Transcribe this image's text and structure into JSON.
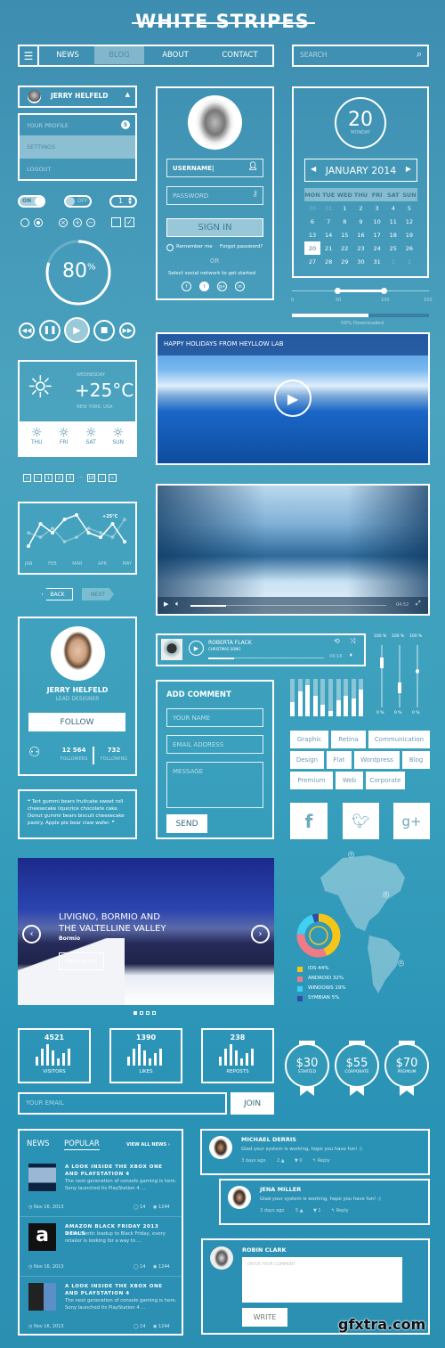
{
  "title": "WHITE STRIPES",
  "nav": {
    "items": [
      "NEWS",
      "BLOG",
      "ABOUT",
      "CONTACT"
    ],
    "active": "BLOG"
  },
  "search": {
    "placeholder": "SEARCH"
  },
  "user_menu": {
    "name": "JERRY HELFELD",
    "items": [
      "YOUR PROFILE",
      "SETTINGS",
      "LOGOUT"
    ],
    "badge": "5",
    "active": "SETTINGS"
  },
  "controls": {
    "toggle_on": "ON",
    "toggle_off": "OFF",
    "stepper_value": "1"
  },
  "gauge": {
    "value": 80,
    "label": "80",
    "unit": "%"
  },
  "login": {
    "username": "USERNAME",
    "password_placeholder": "PASSWORD",
    "sign_in": "SIGN IN",
    "remember": "Remember me",
    "forgot": "Forgot password?",
    "or": "OR",
    "social_text": "Select social network to get started",
    "social": [
      "f",
      "t",
      "g+",
      "in"
    ]
  },
  "calendar": {
    "day": "20",
    "weekday": "MONDAY",
    "month": "JANUARY 2014",
    "headers": [
      "MON",
      "TUE",
      "WED",
      "THU",
      "FRI",
      "SAT",
      "SUN"
    ],
    "weeks": [
      [
        "30",
        "31",
        "1",
        "2",
        "3",
        "4",
        "5"
      ],
      [
        "6",
        "7",
        "8",
        "9",
        "10",
        "11",
        "12"
      ],
      [
        "13",
        "14",
        "15",
        "16",
        "17",
        "18",
        "19"
      ],
      [
        "20",
        "21",
        "22",
        "23",
        "24",
        "25",
        "26"
      ],
      [
        "27",
        "28",
        "29",
        "30",
        "31",
        "1",
        "2"
      ]
    ],
    "selected": "20"
  },
  "range_slider": {
    "ticks": [
      "0",
      "50",
      "100",
      "150"
    ],
    "low": 50,
    "high": 100
  },
  "download": {
    "percent": 56,
    "label": "56% Downloaded"
  },
  "weather": {
    "day": "WEDNESDAY",
    "temp": "+25°C",
    "location": "NEW YORK, USA",
    "forecast": [
      "THU",
      "FRI",
      "SAT",
      "SUN"
    ]
  },
  "video1": {
    "title": "HAPPY HOLIDAYS FROM HEYLLOW LAB"
  },
  "video2": {
    "time": "04:52",
    "progress": 0.18
  },
  "pagination": [
    "«",
    "‹",
    "1",
    "2",
    "3",
    "...",
    "10",
    "›",
    "»"
  ],
  "line_chart": {
    "months": [
      "JAN",
      "FEB",
      "MAR",
      "APR",
      "MAY"
    ],
    "annotation": "+25°C",
    "series1": [
      2,
      7,
      5,
      8,
      9,
      5,
      4,
      7,
      3
    ],
    "series2": [
      5,
      4,
      6,
      3,
      4,
      6,
      5,
      4,
      8
    ]
  },
  "back_next": {
    "back": "BACK",
    "next": "NEXT"
  },
  "profile": {
    "name": "JERRY HELFELD",
    "role": "LEAD DESIGNER",
    "follow": "FOLLOW",
    "followers": "12 564",
    "followers_label": "FOLLOWERS",
    "following": "732",
    "following_label": "FOLLOWING"
  },
  "quote": {
    "text": "Tart gummi bears fruitcake sweet roll cheesecake liquorice chocolate cake. Donut gummi bears biscuit cheesecake pastry. Apple pie bear claw wafer."
  },
  "music": {
    "artist": "ROBERTA FLACK",
    "song": "CHRISTMAS SONG",
    "time": "04:18",
    "progress": 0.22
  },
  "volume": {
    "top_labels": [
      "100 %",
      "100 %",
      "100 %"
    ],
    "bottom_labels": [
      "0 %",
      "0 %",
      "0 %"
    ],
    "levels": [
      0.8,
      0.4,
      0.62
    ]
  },
  "equalizer": [
    0.38,
    0.67,
    0.83,
    0.55,
    0.3,
    0.15,
    0.42,
    0.55,
    0.48,
    0.72
  ],
  "comment_form": {
    "title": "ADD COMMENT",
    "name": "YOUR NAME",
    "email": "EMAIL ADDRESS",
    "message": "MESSAGE",
    "send": "SEND"
  },
  "tags": [
    "Graphic",
    "Retina",
    "Communication",
    "Design",
    "Flat",
    "Wordpress",
    "Blog",
    "Premium",
    "Web",
    "Corporate"
  ],
  "social_buttons": [
    "f",
    "🐦",
    "g+"
  ],
  "slider": {
    "title1": "LIVIGNO,  BORMIO AND",
    "title2": "THE VALTELLINE VALLEY",
    "subtitle": "Bormio",
    "button": "VIEW MORE",
    "slides": 4,
    "active": 0
  },
  "donut": {
    "items": [
      {
        "label": "IOS",
        "value": 44,
        "color": "#f5c518"
      },
      {
        "label": "ANDROID",
        "value": 32,
        "color": "#f07a86"
      },
      {
        "label": "WINDOWS",
        "value": 19,
        "color": "#3fd0f2"
      },
      {
        "label": "SYMBIAN",
        "value": 5,
        "color": "#2e4fa8"
      }
    ],
    "texts": [
      "IOS  44%",
      "ANDROID  32%",
      "WINDOWS  19%",
      "SYMBIAN  5%"
    ]
  },
  "stats": [
    {
      "value": "4521",
      "label": "VISITORS"
    },
    {
      "value": "1390",
      "label": "LIKES"
    },
    {
      "value": "238",
      "label": "REPOSTS"
    }
  ],
  "pricing": [
    {
      "price": "$30",
      "label": "STARTED"
    },
    {
      "price": "$55",
      "label": "CORPORATE"
    },
    {
      "price": "$70",
      "label": "PREMIUM"
    }
  ],
  "newsletter": {
    "placeholder": "YOUR EMAIL",
    "button": "JOIN"
  },
  "news": {
    "tabs": [
      "NEWS",
      "POPULAR"
    ],
    "view_all": "VIEW ALL NEWS ›",
    "items": [
      {
        "title": "A LOOK INSIDE THE XBOX ONE AND PLAYSTATION 4",
        "text": "The next generation of console gaming is here. Sony launched its PlayStation 4 ...",
        "date": "Nov 16, 2013",
        "comments": "14",
        "views": "1244"
      },
      {
        "title": "AMAZON BLACK FRIDAY 2013 DEALS",
        "text": "In the frantic leadup to Black Friday, every retailer is looking for a way to ...",
        "date": "Nov 16, 2013",
        "comments": "14",
        "views": "1244"
      },
      {
        "title": "A LOOK INSIDE THE XBOX ONE AND PLAYSTATION 4",
        "text": "The next generation of console gaming is here. Sony launched its PlayStation 4 ...",
        "date": "Nov 16, 2013",
        "comments": "14",
        "views": "1244"
      }
    ]
  },
  "comments": [
    {
      "name": "MICHAEL DERRIS",
      "text": "Glad your system is working, hope you have fun! :)",
      "ago": "3 days ago",
      "up": "2 ▲",
      "down": "▼ 0",
      "reply": "↰ Reply"
    },
    {
      "name": "JENA MILLER",
      "text": "Glad your system is working, hope you have fun! :)",
      "ago": "3 days ago",
      "up": "5 ▲",
      "down": "▼ 1",
      "reply": "↰ Reply"
    }
  ],
  "write_comment": {
    "name": "ROBIN CLARK",
    "placeholder": "ENTER YOUR COMMENT",
    "button": "WRITE"
  },
  "watermark": "gfxtra.com"
}
